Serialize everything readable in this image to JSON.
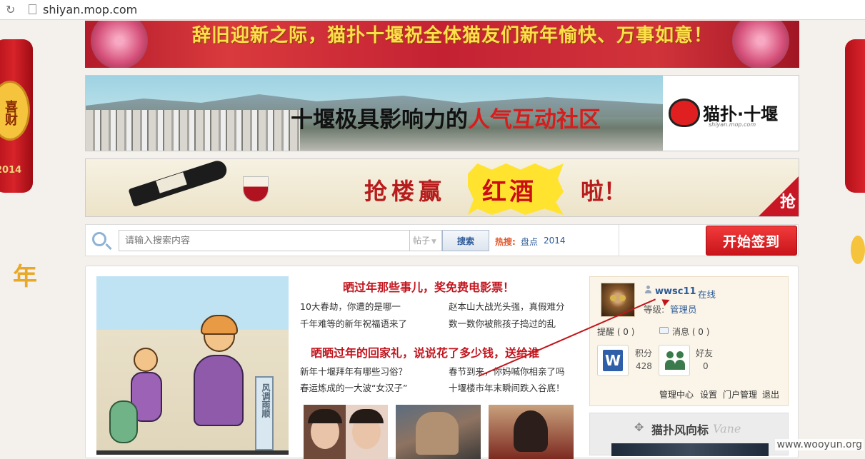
{
  "browser": {
    "url": "shiyan.mop.com"
  },
  "decor": {
    "lantern_left_text": "喜财",
    "lantern_left_year": "2014",
    "side_char": "年"
  },
  "banners": {
    "top_greeting": "辞旧迎新之际，猫扑十堰祝全体猫友们新年愉快、万事如意！",
    "city_slogan_black": "十堰极具影响力的",
    "city_slogan_red": "人气互动社区",
    "logo_text": "猫扑·十堰",
    "logo_sub": "shiyan.mop.com",
    "wine_promo_1": "抢楼赢",
    "wine_promo_highlight": "红酒",
    "wine_promo_2": "啦！",
    "wine_corner": "抢"
  },
  "search": {
    "placeholder": "请输入搜索内容",
    "type_selected": "帖子",
    "button_label": "搜索",
    "hot_label": "热搜:",
    "hot_links": [
      "盘点",
      "2014"
    ]
  },
  "signin": {
    "button_label": "开始签到"
  },
  "featured": {
    "cartoon_sign": "风调雨顺",
    "headline_1": "晒过年那些事儿，奖免费电影票！",
    "headline_1_items": [
      "10大春劫，你遭的是哪一",
      "赵本山大战光头强，真假难分",
      "千年难等的新年祝福语来了",
      "数一数你被熊孩子捣过的乱"
    ],
    "headline_2": "晒晒过年的回家礼，说说花了多少钱，送给谁",
    "headline_2_items": [
      "新年十堰拜年有哪些习俗？",
      "春节到来，你妈喊你相亲了吗",
      "春运炼成的一大波“女汉子”",
      "十堰楼市年末瞬间跌入谷底！"
    ]
  },
  "user": {
    "username": "wwsc11",
    "online_status": "在线",
    "level_label": "等级:",
    "level_value": "管理员",
    "reminders": "提醒 ( 0 )",
    "messages": "消息 ( 0 )",
    "points_label": "积分",
    "points_value": "428",
    "friends_label": "好友",
    "friends_value": "0",
    "links": [
      "管理中心",
      "设置",
      "门户管理",
      "退出"
    ]
  },
  "vane": {
    "title": "猫扑风向标",
    "subtitle": "Vane"
  },
  "watermark": "www.wooyun.org",
  "colors": {
    "headline_red": "#c2161f",
    "link_blue": "#2b5a98",
    "signin_red": "#d9232a",
    "annotation_arrow": "#c0161b"
  }
}
